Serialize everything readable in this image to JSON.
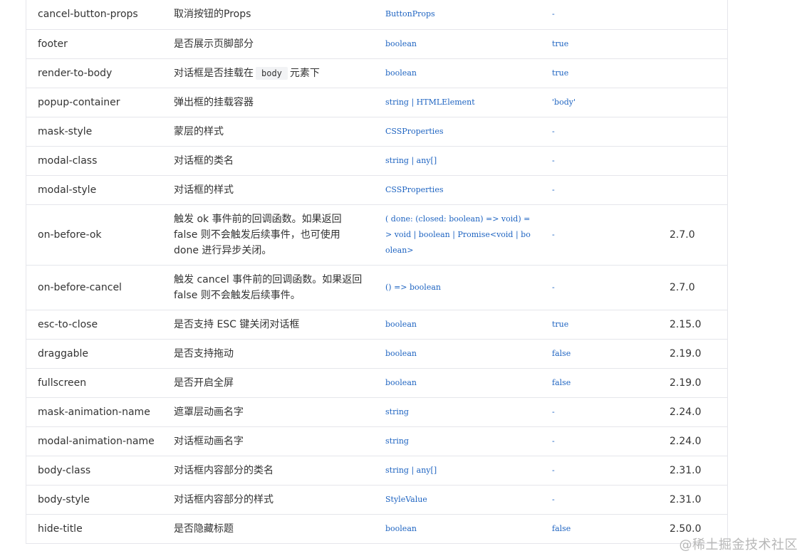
{
  "table": {
    "rows": [
      {
        "name": "cancel-button-props",
        "desc": "取消按钮的Props",
        "type": "ButtonProps",
        "default": "-",
        "version": ""
      },
      {
        "name": "footer",
        "desc": "是否展示页脚部分",
        "type": "boolean",
        "default": "true",
        "version": ""
      },
      {
        "name": "render-to-body",
        "desc_pre": "对话框是否挂载在",
        "desc_code": "body",
        "desc_post": "元素下",
        "type": "boolean",
        "default": "true",
        "version": ""
      },
      {
        "name": "popup-container",
        "desc": "弹出框的挂载容器",
        "type": "string | HTMLElement",
        "default": "'body'",
        "version": ""
      },
      {
        "name": "mask-style",
        "desc": "蒙层的样式",
        "type": "CSSProperties",
        "default": "-",
        "version": ""
      },
      {
        "name": "modal-class",
        "desc": "对话框的类名",
        "type": "string | any[]",
        "default": "-",
        "version": ""
      },
      {
        "name": "modal-style",
        "desc": "对话框的样式",
        "type": "CSSProperties",
        "default": "-",
        "version": ""
      },
      {
        "name": "on-before-ok",
        "desc": "触发 ok 事件前的回调函数。如果返回 false 则不会触发后续事件，也可使用 done 进行异步关闭。",
        "type": "( done: (closed: boolean) => void) => void | boolean | Promise<void | boolean>",
        "default": "-",
        "version": "2.7.0"
      },
      {
        "name": "on-before-cancel",
        "desc": "触发 cancel 事件前的回调函数。如果返回 false 则不会触发后续事件。",
        "type": "() => boolean",
        "default": "-",
        "version": "2.7.0"
      },
      {
        "name": "esc-to-close",
        "desc": "是否支持 ESC 键关闭对话框",
        "type": "boolean",
        "default": "true",
        "version": "2.15.0"
      },
      {
        "name": "draggable",
        "desc": "是否支持拖动",
        "type": "boolean",
        "default": "false",
        "version": "2.19.0"
      },
      {
        "name": "fullscreen",
        "desc": "是否开启全屏",
        "type": "boolean",
        "default": "false",
        "version": "2.19.0"
      },
      {
        "name": "mask-animation-name",
        "desc": "遮罩层动画名字",
        "type": "string",
        "default": "-",
        "version": "2.24.0"
      },
      {
        "name": "modal-animation-name",
        "desc": "对话框动画名字",
        "type": "string",
        "default": "-",
        "version": "2.24.0"
      },
      {
        "name": "body-class",
        "desc": "对话框内容部分的类名",
        "type": "string | any[]",
        "default": "-",
        "version": "2.31.0"
      },
      {
        "name": "body-style",
        "desc": "对话框内容部分的样式",
        "type": "StyleValue",
        "default": "-",
        "version": "2.31.0"
      },
      {
        "name": "hide-title",
        "desc": "是否隐藏标题",
        "type": "boolean",
        "default": "false",
        "version": "2.50.0"
      }
    ]
  },
  "watermark": "@稀土掘金技术社区"
}
